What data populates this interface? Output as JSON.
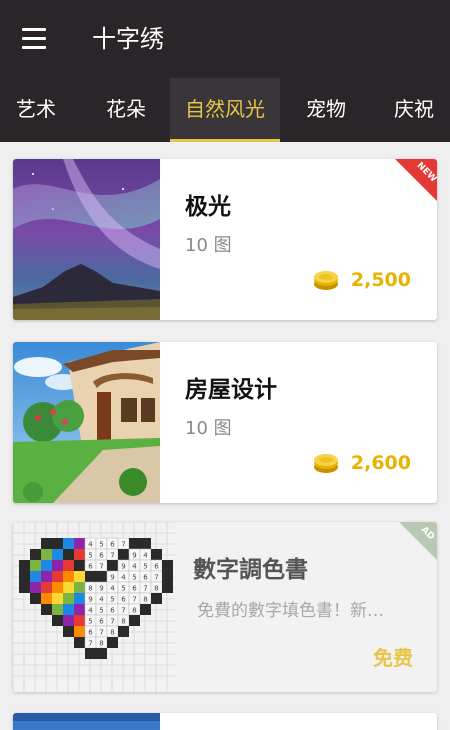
{
  "app": {
    "title": "十字绣"
  },
  "tabs": [
    {
      "label": "艺术"
    },
    {
      "label": "花朵"
    },
    {
      "label": "自然风光",
      "active": true
    },
    {
      "label": "宠物"
    },
    {
      "label": "庆祝"
    }
  ],
  "cards": [
    {
      "title": "极光",
      "subtitle": "10 图",
      "price": "2,500",
      "badge": "NEW",
      "image": "aurora-over-mountain"
    },
    {
      "title": "房屋设计",
      "subtitle": "10 图",
      "price": "2,600",
      "image": "house-with-garden"
    }
  ],
  "ad": {
    "title": "數字調色書",
    "description": "免費的數字填色書！新…",
    "cta": "免费",
    "badge": "AD",
    "image": "pixel-heart-color-by-number"
  },
  "colors": {
    "appbar": "#2a2528",
    "accent": "#e6c64a",
    "coin": "#e6b400",
    "new_badge": "#e53935",
    "ad_badge": "#b8c9b4"
  }
}
